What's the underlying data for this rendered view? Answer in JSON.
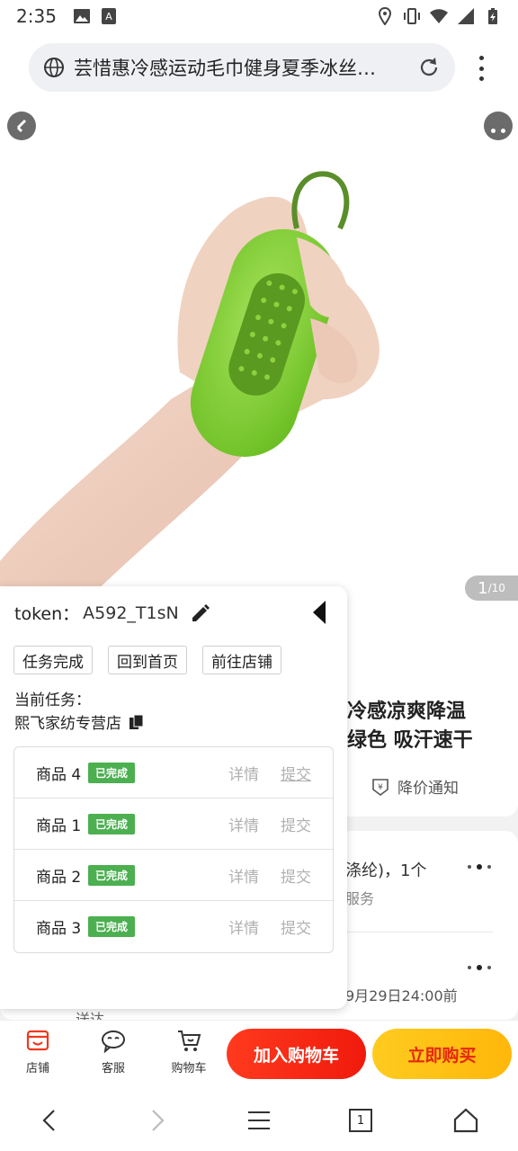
{
  "status_bar": {
    "time": "2:35",
    "left_icons": [
      "image-icon",
      "a-notification-icon"
    ],
    "right_icons": [
      "location-icon",
      "vibrate-icon",
      "wifi-icon",
      "signal-icon",
      "battery-icon"
    ]
  },
  "address_bar": {
    "url_text": "芸惜惠冷感运动毛巾健身夏季冰丝…",
    "icons": [
      "globe-icon",
      "reload-icon",
      "menu-dots-icon"
    ]
  },
  "product": {
    "image_counter_current": "1",
    "image_counter_total": "/10",
    "title": "冷感凉爽降温\n绿色 吸汗速干",
    "price_notice_label": "降价通知",
    "spec_line1": "涤纶)，1个",
    "spec_line2": "服务",
    "ship_line": "9月29日24:00前",
    "deliver_text": "送达"
  },
  "action_bar": {
    "shop_label": "店铺",
    "service_label": "客服",
    "cart_label": "购物车",
    "add_to_cart_label": "加入购物车",
    "buy_now_label": "立即购买",
    "colors": {
      "cart_button": "#f01a0c",
      "buy_button": "#ffb70a",
      "accent": "#e6260c"
    }
  },
  "task_panel": {
    "token_label": "token：",
    "token_value": "A592_T1sN",
    "buttons": [
      "任务完成",
      "回到首页",
      "前往店铺"
    ],
    "current_task_label": "当前任务：",
    "current_task_value": "熙飞家纺专营店",
    "tasks": [
      {
        "name": "商品 4",
        "status": "已完成",
        "detail": "详情",
        "submit": "提交"
      },
      {
        "name": "商品 1",
        "status": "已完成",
        "detail": "详情",
        "submit": "提交"
      },
      {
        "name": "商品 2",
        "status": "已完成",
        "detail": "详情",
        "submit": "提交"
      },
      {
        "name": "商品 3",
        "status": "已完成",
        "detail": "详情",
        "submit": "提交"
      }
    ],
    "colors": {
      "badge": "#4caf50"
    }
  },
  "nav_bar": {
    "tab_count": "1",
    "icons": [
      "back-icon",
      "forward-icon",
      "menu-icon",
      "tabs-icon",
      "home-icon"
    ]
  }
}
